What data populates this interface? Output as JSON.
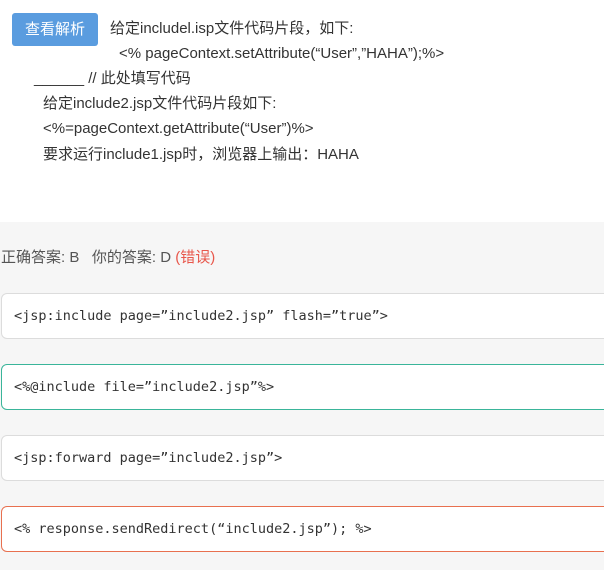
{
  "question": {
    "analysis_button": "查看解析",
    "lines": [
      "给定includel.isp文件代码片段，如下:",
      "<% pageContext.setAttribute(“User”,”HAHA”);%>",
      "______ // 此处填写代码",
      "给定include2.jsp文件代码片段如下:",
      "<%=pageContext.getAttribute(“User”)%>",
      "要求运行include1.jsp时，浏览器上输出：HAHA"
    ]
  },
  "answer": {
    "correct_label": "正确答案: B",
    "your_label": "你的答案: D",
    "status": "(错误)"
  },
  "options": [
    {
      "text": "<jsp:include page=”include2.jsp” flash=”true”>",
      "state": "normal"
    },
    {
      "text": "<%@include file=”include2.jsp”%>",
      "state": "correct"
    },
    {
      "text": "<jsp:forward page=”include2.jsp”>",
      "state": "normal"
    },
    {
      "text": "<% response.sendRedirect(“include2.jsp”); %>",
      "state": "wrong"
    }
  ],
  "colors": {
    "button": "#5a9cdf",
    "correct_border": "#3ab59a",
    "wrong_border": "#e8704f",
    "wrong_text": "#e8574b"
  }
}
